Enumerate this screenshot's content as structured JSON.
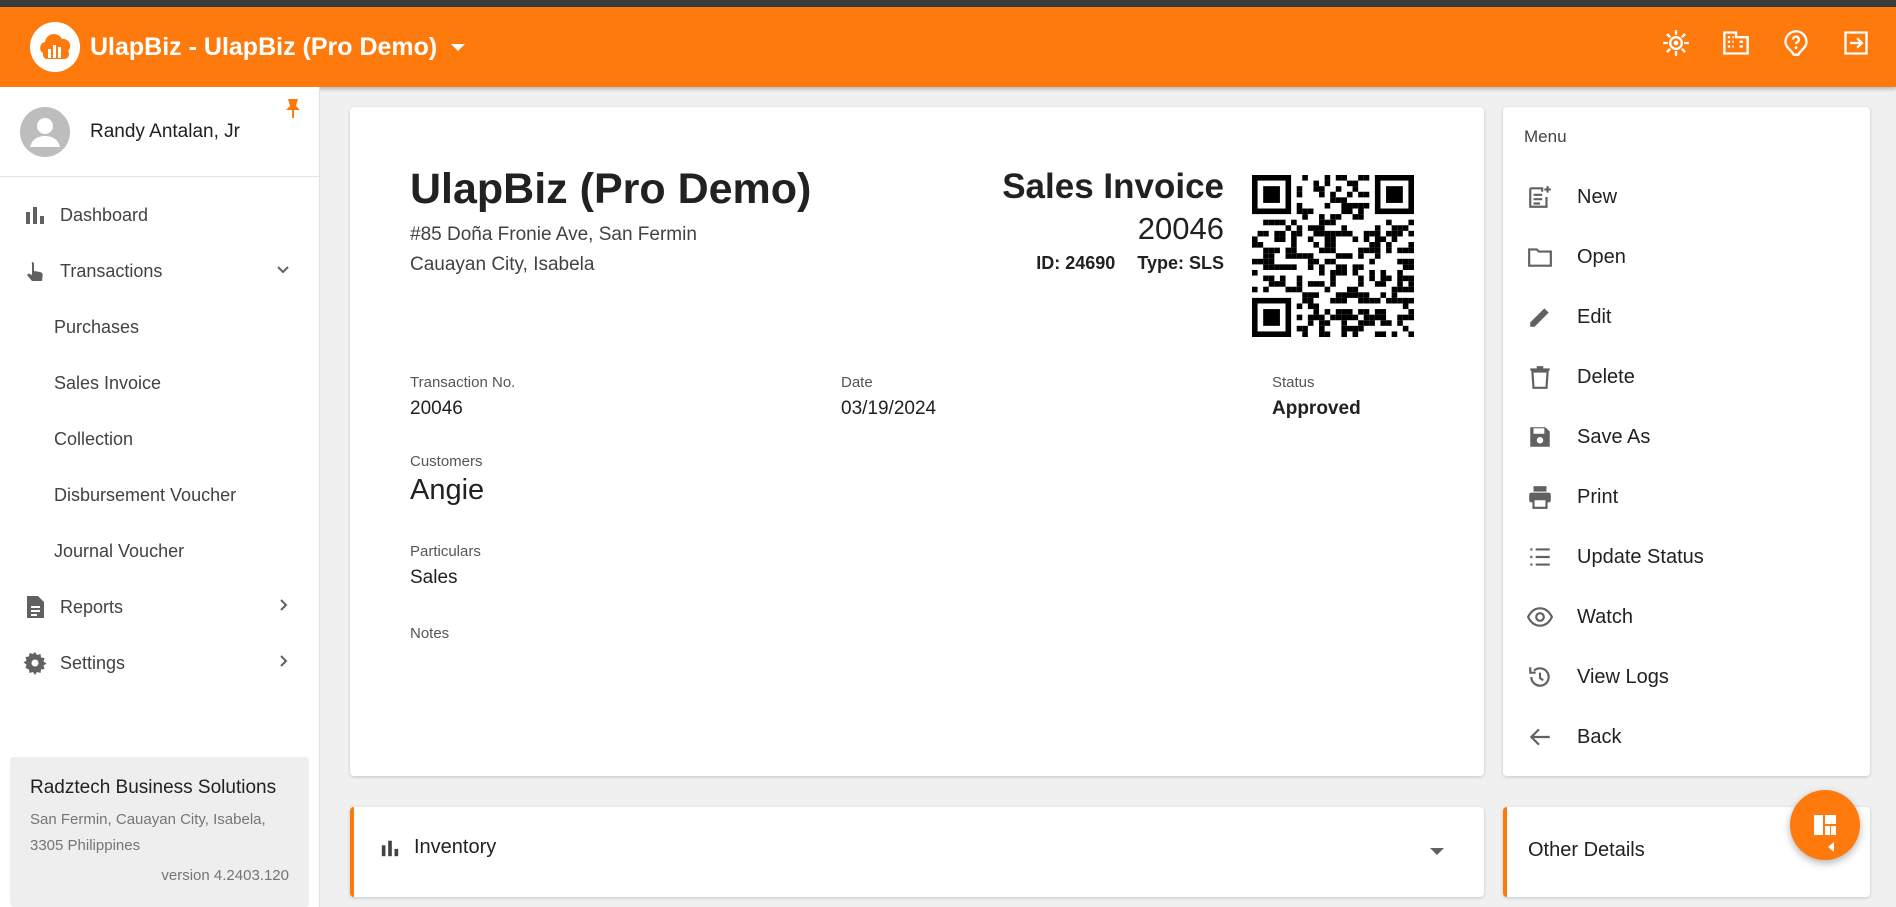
{
  "header": {
    "title": "UlapBiz -  UlapBiz (Pro Demo)",
    "brand_color": "#ff7a0d",
    "actions": [
      {
        "name": "brightness-icon"
      },
      {
        "name": "building-icon"
      },
      {
        "name": "help-icon"
      },
      {
        "name": "logout-icon"
      }
    ]
  },
  "sidebar": {
    "user_name": "Randy Antalan, Jr",
    "items": [
      {
        "label": "Dashboard",
        "icon": "bar-chart-icon"
      },
      {
        "label": "Transactions",
        "icon": "touch-icon",
        "expanded": true
      },
      {
        "label": "Reports",
        "icon": "document-icon"
      },
      {
        "label": "Settings",
        "icon": "gear-icon"
      }
    ],
    "sub_items": [
      "Purchases",
      "Sales Invoice",
      "Collection",
      "Disbursement Voucher",
      "Journal Voucher"
    ],
    "company": {
      "name": "Radztech Business Solutions",
      "address_line1": "San Fermin, Cauayan City, Isabela,",
      "address_line2": "3305 Philippines",
      "version": "version 4.2403.120"
    }
  },
  "document": {
    "company_name": "UlapBiz (Pro Demo)",
    "address_line1": "#85 Doña Fronie Ave, San Fermin",
    "address_line2": "Cauayan City, Isabela",
    "doc_type": "Sales Invoice",
    "doc_number": "20046",
    "id_text": "ID: 24690",
    "type_text": "Type: SLS",
    "fields": {
      "transaction_no_label": "Transaction No.",
      "transaction_no": "20046",
      "date_label": "Date",
      "date": "03/19/2024",
      "status_label": "Status",
      "status": "Approved",
      "customers_label": "Customers",
      "customer": "Angie",
      "particulars_label": "Particulars",
      "particulars": "Sales",
      "notes_label": "Notes"
    }
  },
  "menu": {
    "heading": "Menu",
    "items": [
      {
        "label": "New",
        "icon": "new-document-icon"
      },
      {
        "label": "Open",
        "icon": "folder-icon"
      },
      {
        "label": "Edit",
        "icon": "pencil-icon"
      },
      {
        "label": "Delete",
        "icon": "trash-icon"
      },
      {
        "label": "Save As",
        "icon": "save-icon"
      },
      {
        "label": "Print",
        "icon": "printer-icon"
      },
      {
        "label": "Update Status",
        "icon": "list-icon"
      },
      {
        "label": "Watch",
        "icon": "eye-icon"
      },
      {
        "label": "View Logs",
        "icon": "history-icon"
      },
      {
        "label": "Back",
        "icon": "arrow-left-icon"
      }
    ]
  },
  "panels": {
    "inventory_label": "Inventory",
    "other_details_label": "Other Details"
  }
}
